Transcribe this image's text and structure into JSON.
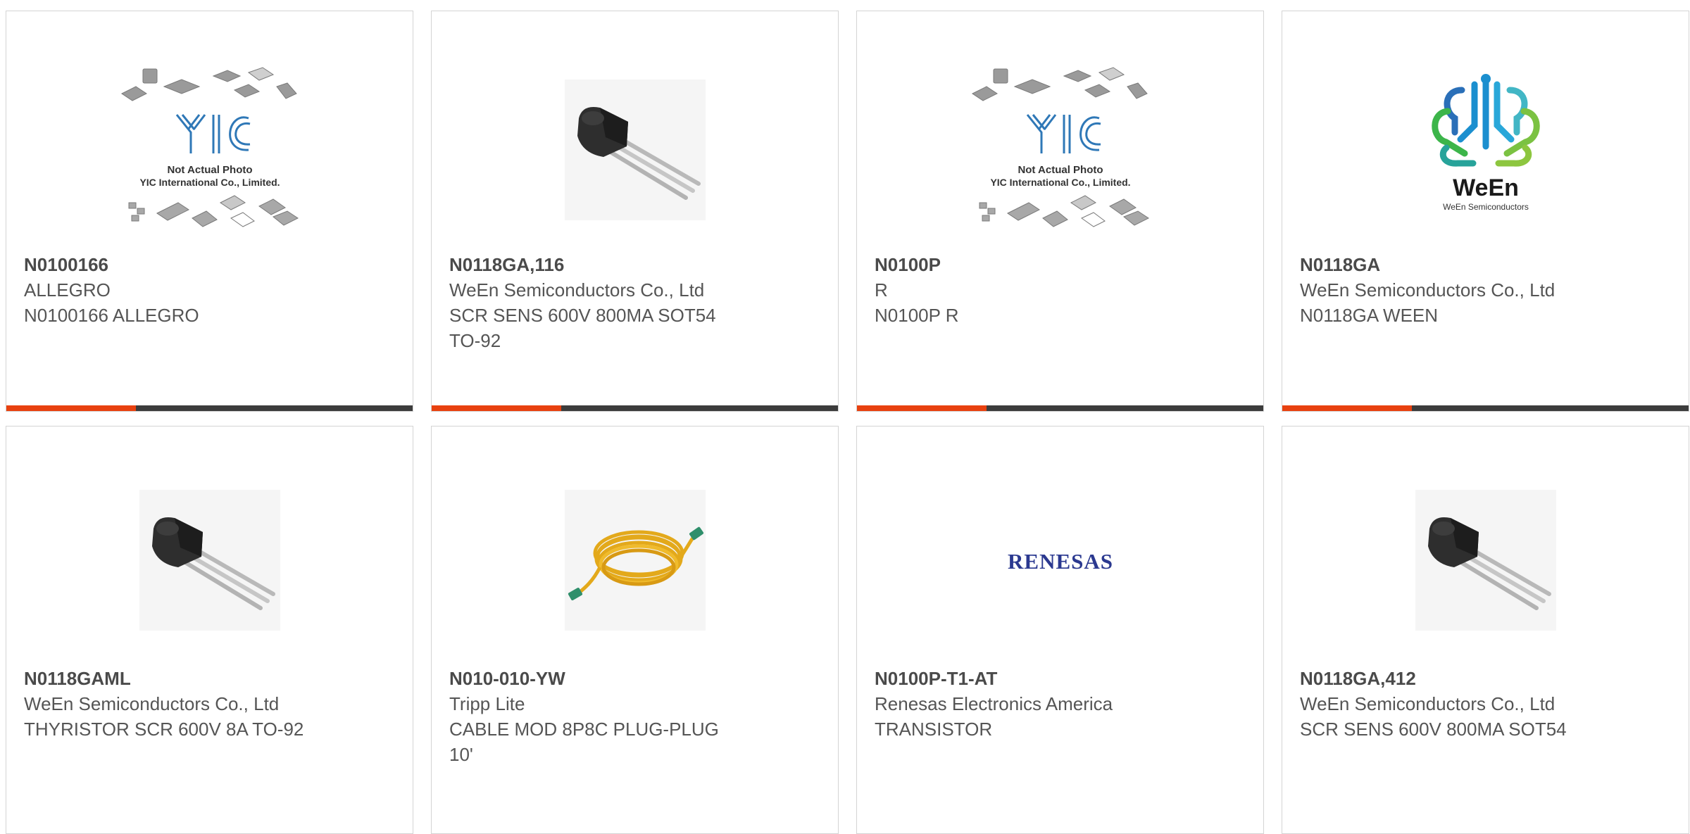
{
  "colors": {
    "accent": "#e8410f",
    "bar": "#3c3c3c",
    "border": "#d4d4d4",
    "text": "#555555"
  },
  "products": [
    {
      "part_number": "N0100166",
      "manufacturer": "ALLEGRO",
      "description": "N0100166 ALLEGRO",
      "image": "yic-not-actual-photo",
      "image_text": [
        "Not Actual Photo",
        "YIC International Co., Limited."
      ]
    },
    {
      "part_number": "N0118GA,116",
      "manufacturer": "WeEn Semiconductors Co., Ltd",
      "description": "SCR SENS 600V 800MA SOT54 TO-92",
      "image": "to92-transistor"
    },
    {
      "part_number": "N0100P",
      "manufacturer": "R",
      "description": "N0100P R",
      "image": "yic-not-actual-photo",
      "image_text": [
        "Not Actual Photo",
        "YIC International Co., Limited."
      ]
    },
    {
      "part_number": "N0118GA",
      "manufacturer": "WeEn Semiconductors Co., Ltd",
      "description": "N0118GA WEEN",
      "image": "ween-logo",
      "image_text": [
        "WeEn",
        "WeEn Semiconductors"
      ]
    },
    {
      "part_number": "N0118GAML",
      "manufacturer": "WeEn Semiconductors Co., Ltd",
      "description": "THYRISTOR SCR 600V 8A TO-92",
      "image": "to92-transistor"
    },
    {
      "part_number": "N010-010-YW",
      "manufacturer": "Tripp Lite",
      "description": "CABLE MOD 8P8C PLUG-PLUG 10'",
      "image": "yellow-ethernet-cable"
    },
    {
      "part_number": "N0100P-T1-AT",
      "manufacturer": "Renesas Electronics America",
      "description": "TRANSISTOR",
      "image": "renesas-logo",
      "image_text": [
        "RENESAS"
      ]
    },
    {
      "part_number": "N0118GA,412",
      "manufacturer": "WeEn Semiconductors Co., Ltd",
      "description": "SCR SENS 600V 800MA SOT54",
      "image": "to92-transistor"
    }
  ]
}
